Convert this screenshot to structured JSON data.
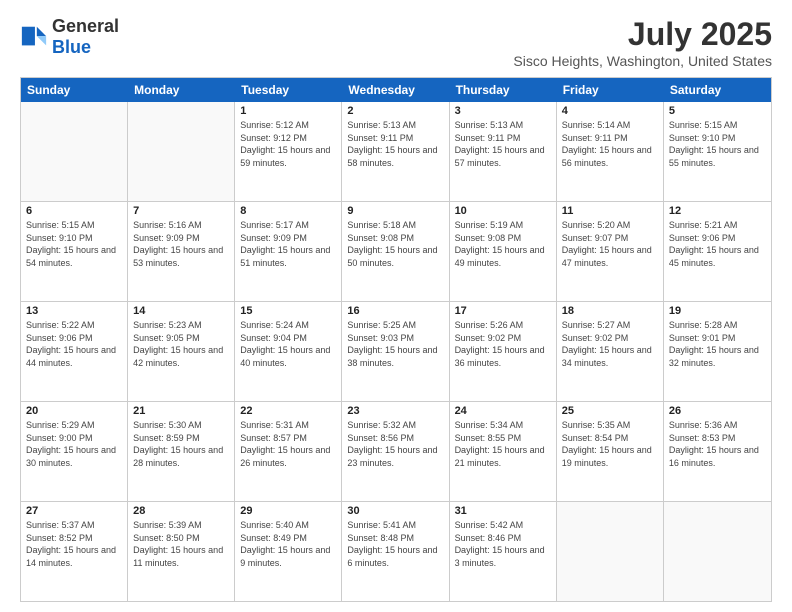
{
  "logo": {
    "general": "General",
    "blue": "Blue"
  },
  "header": {
    "month": "July 2025",
    "location": "Sisco Heights, Washington, United States"
  },
  "days_of_week": [
    "Sunday",
    "Monday",
    "Tuesday",
    "Wednesday",
    "Thursday",
    "Friday",
    "Saturday"
  ],
  "weeks": [
    [
      {
        "day": "",
        "empty": true
      },
      {
        "day": "",
        "empty": true
      },
      {
        "day": "1",
        "sunrise": "5:12 AM",
        "sunset": "9:12 PM",
        "daylight": "15 hours and 59 minutes."
      },
      {
        "day": "2",
        "sunrise": "5:13 AM",
        "sunset": "9:11 PM",
        "daylight": "15 hours and 58 minutes."
      },
      {
        "day": "3",
        "sunrise": "5:13 AM",
        "sunset": "9:11 PM",
        "daylight": "15 hours and 57 minutes."
      },
      {
        "day": "4",
        "sunrise": "5:14 AM",
        "sunset": "9:11 PM",
        "daylight": "15 hours and 56 minutes."
      },
      {
        "day": "5",
        "sunrise": "5:15 AM",
        "sunset": "9:10 PM",
        "daylight": "15 hours and 55 minutes."
      }
    ],
    [
      {
        "day": "6",
        "sunrise": "5:15 AM",
        "sunset": "9:10 PM",
        "daylight": "15 hours and 54 minutes."
      },
      {
        "day": "7",
        "sunrise": "5:16 AM",
        "sunset": "9:09 PM",
        "daylight": "15 hours and 53 minutes."
      },
      {
        "day": "8",
        "sunrise": "5:17 AM",
        "sunset": "9:09 PM",
        "daylight": "15 hours and 51 minutes."
      },
      {
        "day": "9",
        "sunrise": "5:18 AM",
        "sunset": "9:08 PM",
        "daylight": "15 hours and 50 minutes."
      },
      {
        "day": "10",
        "sunrise": "5:19 AM",
        "sunset": "9:08 PM",
        "daylight": "15 hours and 49 minutes."
      },
      {
        "day": "11",
        "sunrise": "5:20 AM",
        "sunset": "9:07 PM",
        "daylight": "15 hours and 47 minutes."
      },
      {
        "day": "12",
        "sunrise": "5:21 AM",
        "sunset": "9:06 PM",
        "daylight": "15 hours and 45 minutes."
      }
    ],
    [
      {
        "day": "13",
        "sunrise": "5:22 AM",
        "sunset": "9:06 PM",
        "daylight": "15 hours and 44 minutes."
      },
      {
        "day": "14",
        "sunrise": "5:23 AM",
        "sunset": "9:05 PM",
        "daylight": "15 hours and 42 minutes."
      },
      {
        "day": "15",
        "sunrise": "5:24 AM",
        "sunset": "9:04 PM",
        "daylight": "15 hours and 40 minutes."
      },
      {
        "day": "16",
        "sunrise": "5:25 AM",
        "sunset": "9:03 PM",
        "daylight": "15 hours and 38 minutes."
      },
      {
        "day": "17",
        "sunrise": "5:26 AM",
        "sunset": "9:02 PM",
        "daylight": "15 hours and 36 minutes."
      },
      {
        "day": "18",
        "sunrise": "5:27 AM",
        "sunset": "9:02 PM",
        "daylight": "15 hours and 34 minutes."
      },
      {
        "day": "19",
        "sunrise": "5:28 AM",
        "sunset": "9:01 PM",
        "daylight": "15 hours and 32 minutes."
      }
    ],
    [
      {
        "day": "20",
        "sunrise": "5:29 AM",
        "sunset": "9:00 PM",
        "daylight": "15 hours and 30 minutes."
      },
      {
        "day": "21",
        "sunrise": "5:30 AM",
        "sunset": "8:59 PM",
        "daylight": "15 hours and 28 minutes."
      },
      {
        "day": "22",
        "sunrise": "5:31 AM",
        "sunset": "8:57 PM",
        "daylight": "15 hours and 26 minutes."
      },
      {
        "day": "23",
        "sunrise": "5:32 AM",
        "sunset": "8:56 PM",
        "daylight": "15 hours and 23 minutes."
      },
      {
        "day": "24",
        "sunrise": "5:34 AM",
        "sunset": "8:55 PM",
        "daylight": "15 hours and 21 minutes."
      },
      {
        "day": "25",
        "sunrise": "5:35 AM",
        "sunset": "8:54 PM",
        "daylight": "15 hours and 19 minutes."
      },
      {
        "day": "26",
        "sunrise": "5:36 AM",
        "sunset": "8:53 PM",
        "daylight": "15 hours and 16 minutes."
      }
    ],
    [
      {
        "day": "27",
        "sunrise": "5:37 AM",
        "sunset": "8:52 PM",
        "daylight": "15 hours and 14 minutes."
      },
      {
        "day": "28",
        "sunrise": "5:39 AM",
        "sunset": "8:50 PM",
        "daylight": "15 hours and 11 minutes."
      },
      {
        "day": "29",
        "sunrise": "5:40 AM",
        "sunset": "8:49 PM",
        "daylight": "15 hours and 9 minutes."
      },
      {
        "day": "30",
        "sunrise": "5:41 AM",
        "sunset": "8:48 PM",
        "daylight": "15 hours and 6 minutes."
      },
      {
        "day": "31",
        "sunrise": "5:42 AM",
        "sunset": "8:46 PM",
        "daylight": "15 hours and 3 minutes."
      },
      {
        "day": "",
        "empty": true
      },
      {
        "day": "",
        "empty": true
      }
    ]
  ]
}
